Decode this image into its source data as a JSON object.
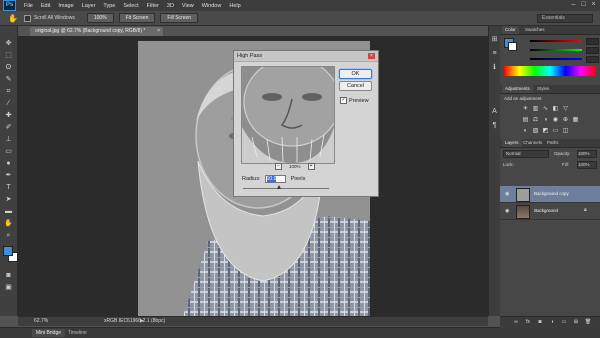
{
  "app": {
    "logo": "Ps"
  },
  "menu": [
    "File",
    "Edit",
    "Image",
    "Layer",
    "Type",
    "Select",
    "Filter",
    "3D",
    "View",
    "Window",
    "Help"
  ],
  "options": {
    "scroll_all_windows": "Scroll All Windows",
    "zoom_100": "100%",
    "fit_screen": "Fit Screen",
    "fill_screen": "Fill Screen",
    "workspace": "Essentials"
  },
  "document": {
    "tab_title": "original.jpg @ 62.7% (Background copy, RGB/8) *"
  },
  "status": {
    "zoom": "62.7%",
    "profile": "sRGB IEC61966-2.1 (8bpc)"
  },
  "bottom_tabs": [
    "Mini Bridge",
    "Timeline"
  ],
  "dialog": {
    "title": "High Pass",
    "ok_label": "OK",
    "cancel_label": "Cancel",
    "preview_label": "Preview",
    "preview_checked": true,
    "zoom_level": "100%",
    "radius_label": "Radius:",
    "radius_value": "10.0",
    "radius_unit": "Pixels"
  },
  "panels": {
    "color_tabs": [
      "Color",
      "Swatches"
    ],
    "adjust_tabs": [
      "Adjustments",
      "Styles"
    ],
    "add_adjustment": "Add an adjustment",
    "layers_tabs": [
      "Layers",
      "Channels",
      "Paths"
    ],
    "blend_mode": "Normal",
    "opacity_label": "Opacity:",
    "opacity_value": "100%",
    "lock_label": "Lock:",
    "fill_label": "Fill:",
    "fill_value": "100%",
    "layers": [
      {
        "name": "Background copy",
        "selected": true
      },
      {
        "name": "Background",
        "selected": false
      }
    ]
  },
  "colors": {
    "foreground": "#3d8fd9",
    "background": "#ffffff",
    "accent": "#3b6fd6"
  }
}
